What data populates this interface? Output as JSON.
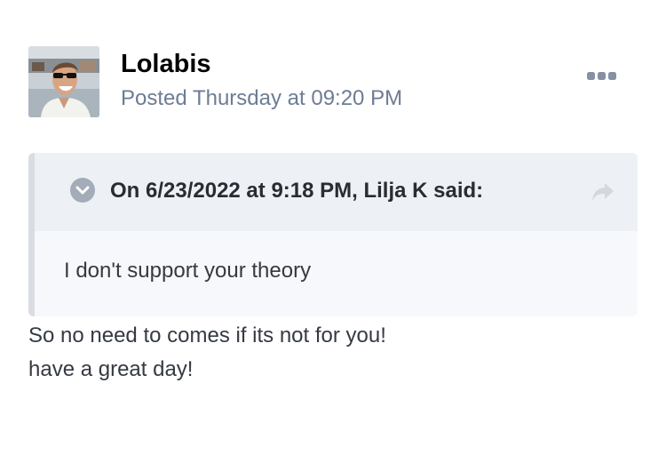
{
  "post": {
    "author": {
      "name": "Lolabis",
      "avatar_icon": "user-avatar-photo"
    },
    "posted_label": "Posted Thursday at 09:20 PM",
    "menu_icon": "more-options-icon",
    "quote": {
      "citation": "On 6/23/2022 at 9:18 PM, Lilja K said:",
      "text": "I don't support your theory",
      "toggle_icon": "chevron-down-circle-icon",
      "share_icon": "share-arrow-icon"
    },
    "body_lines": [
      "So no need to comes if its not for you!",
      "have a great day!"
    ]
  },
  "colors": {
    "meta_text": "#6d7c94",
    "quote_header_bg": "#edf1f5",
    "quote_body_bg": "#f6f8fb",
    "quote_bar": "#d9dde3",
    "icon_gray": "#a3acb8",
    "body_text": "#353a42"
  }
}
